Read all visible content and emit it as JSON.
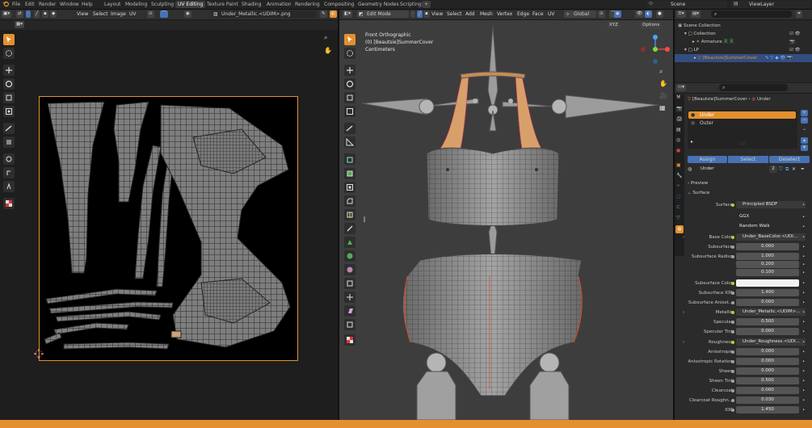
{
  "app": {
    "menus": [
      "File",
      "Edit",
      "Render",
      "Window",
      "Help"
    ],
    "workspace_tabs": [
      {
        "label": "Layout",
        "active": false
      },
      {
        "label": "Modeling",
        "active": false
      },
      {
        "label": "Sculpting",
        "active": false
      },
      {
        "label": "UV Editing",
        "active": true
      },
      {
        "label": "Texture Paint",
        "active": false
      },
      {
        "label": "Shading",
        "active": false
      },
      {
        "label": "Animation",
        "active": false
      },
      {
        "label": "Rendering",
        "active": false
      },
      {
        "label": "Compositing",
        "active": false
      },
      {
        "label": "Geometry Nodes",
        "active": false
      },
      {
        "label": "Scripting",
        "active": false
      }
    ],
    "add_tab": "+",
    "scene": "Scene",
    "view_layer": "ViewLayer"
  },
  "uv_editor": {
    "menus": [
      "View",
      "Select",
      "Image",
      "UV"
    ],
    "image_name": "Under_Metallic.<UDIM>.png"
  },
  "viewport": {
    "mode": "Edit Mode",
    "menus": [
      "View",
      "Select",
      "Add",
      "Mesh",
      "Vertex",
      "Edge",
      "Face",
      "UV"
    ],
    "orientation": "Global",
    "options": "Options",
    "overlay_title": "Front Orthographic",
    "overlay_object": "(0) [Beautsie]SummerCover",
    "overlay_units": "Centimeters"
  },
  "outliner": {
    "search_placeholder": "",
    "items": [
      {
        "label": "Scene Collection",
        "level": 0
      },
      {
        "label": "Collection",
        "level": 1
      },
      {
        "label": "Armature",
        "level": 2
      },
      {
        "label": "LP",
        "level": 1
      },
      {
        "label": "[Beautsie]SummerCover",
        "level": 2,
        "selected": true
      }
    ]
  },
  "properties": {
    "breadcrumb_object": "[Beautsie]SummerCover",
    "breadcrumb_material": "Under",
    "slots": [
      "Under",
      "Outer"
    ],
    "assign": "Assign",
    "select": "Select",
    "deselect": "Deselect",
    "material_name": "Under",
    "user_count": "2",
    "preview_panel": "Preview",
    "surface_panel": "Surface",
    "rows": [
      {
        "label": "Surface",
        "value": "Principled BSDF",
        "type": "link"
      },
      {
        "label": "",
        "value": "GGX",
        "type": "dark"
      },
      {
        "label": "",
        "value": "Random Walk",
        "type": "dark"
      },
      {
        "label": "Base Color",
        "value": "Under_BaseColor.<UDI...",
        "type": "link"
      },
      {
        "label": "Subsurface",
        "value": "0.000",
        "type": "num"
      },
      {
        "label": "Subsurface Radius",
        "value": "1.000",
        "type": "num"
      },
      {
        "label": "",
        "value": "0.200",
        "type": "num"
      },
      {
        "label": "",
        "value": "0.100",
        "type": "num"
      },
      {
        "label": "Subsurface Color",
        "value": "",
        "type": "color"
      },
      {
        "label": "Subsurface IOR",
        "value": "1.400",
        "type": "num"
      },
      {
        "label": "Subsurface Anisot...",
        "value": "0.000",
        "type": "num"
      },
      {
        "label": "Metallic",
        "value": "Under_Metallic.<UDIM>...",
        "type": "link"
      },
      {
        "label": "Specular",
        "value": "0.500",
        "type": "num"
      },
      {
        "label": "Specular Tint",
        "value": "0.000",
        "type": "num"
      },
      {
        "label": "Roughness",
        "value": "Under_Roughness.<UDI...",
        "type": "link"
      },
      {
        "label": "Anisotropic",
        "value": "0.000",
        "type": "num"
      },
      {
        "label": "Anisotropic Rotation",
        "value": "0.000",
        "type": "num"
      },
      {
        "label": "Sheen",
        "value": "0.000",
        "type": "num"
      },
      {
        "label": "Sheen Tint",
        "value": "0.500",
        "type": "num"
      },
      {
        "label": "Clearcoat",
        "value": "0.000",
        "type": "num"
      },
      {
        "label": "Clearcoat Roughn...",
        "value": "0.030",
        "type": "num"
      },
      {
        "label": "IOR",
        "value": "1.450",
        "type": "num"
      }
    ]
  },
  "colors": {
    "accent": "#e3902e",
    "selection_blue": "#4772b3",
    "panel": "#303030",
    "background": "#1d1d1d",
    "mesh": "#9a9a9a",
    "wire": "#3a3a3a"
  }
}
